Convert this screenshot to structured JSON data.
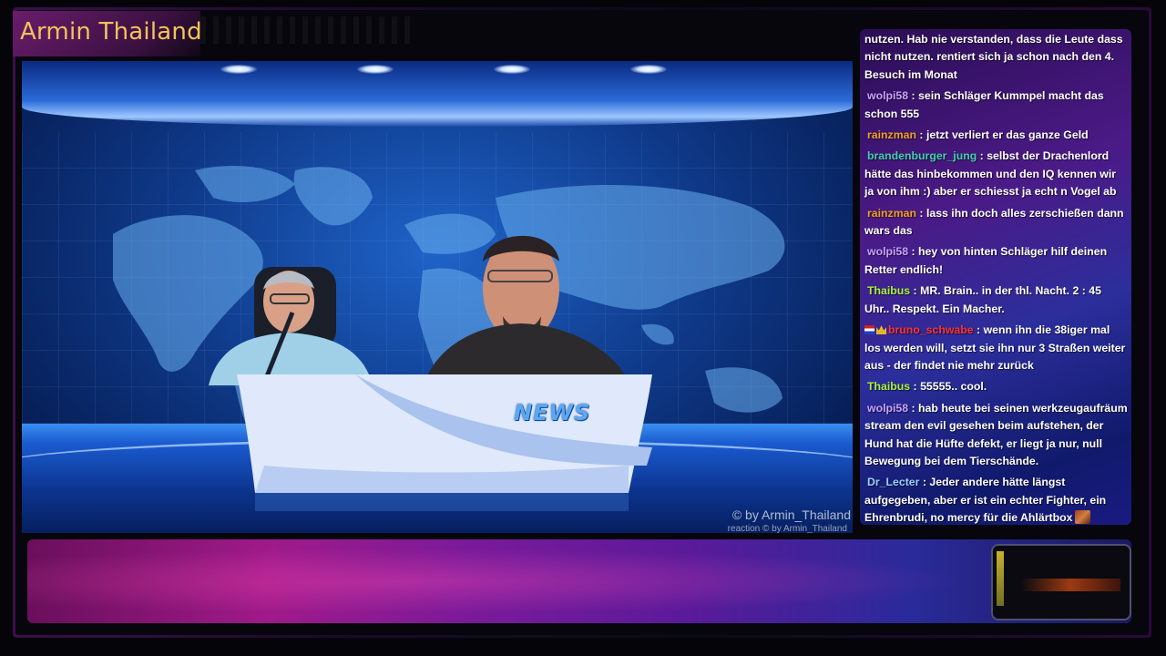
{
  "stream": {
    "title": "Armin Thailand",
    "watermark_main": "© by Armin_Thailand",
    "watermark_sub": "reaction  © by Armin_Thailand",
    "desk_label": "NEWS"
  },
  "chat": {
    "messages": [
      {
        "user": "",
        "text": "nutzen. Hab nie verstanden, dass die Leute dass nicht nutzen. rentiert sich ja schon nach den 4. Besuch im Monat",
        "color": "#ffffff"
      },
      {
        "user": "wolpi58",
        "text": "sein Schläger Kummpel macht das schon 555",
        "color": "#c9a2ff"
      },
      {
        "user": "rainzman",
        "text": "jetzt verliert er das ganze Geld",
        "color": "#f0a020"
      },
      {
        "user": "brandenburger_jung",
        "text": "selbst der Drachenlord hätte das hinbekommen und den IQ kennen wir ja von ihm :) aber er schiesst ja echt n Vogel ab",
        "color": "#40d0b0"
      },
      {
        "user": "rainzman",
        "text": "lass ihn doch alles zerschießen dann wars das",
        "color": "#f0a020"
      },
      {
        "user": "wolpi58",
        "text": "hey von hinten Schläger hilf deinen Retter endlich!",
        "color": "#c9a2ff"
      },
      {
        "user": "Thaibus",
        "text": "MR. Brain.. in der thl. Nacht. 2 : 45 Uhr.. Respekt. Ein Macher.",
        "color": "#a8f040"
      },
      {
        "user": "bruno_schwabe",
        "text": "wenn ihn die 38iger mal los werden will, setzt sie ihn nur 3 Straßen weiter aus - der findet nie mehr zurück",
        "color": "#ff3030",
        "badges": [
          "flag-de",
          "crown"
        ]
      },
      {
        "user": "Thaibus",
        "text": "55555.. cool.",
        "color": "#a8f040"
      },
      {
        "user": "wolpi58",
        "text": "hab heute bei seinen werkzeugaufräum stream den evil gesehen beim aufstehen, der Hund hat die Hüfte defekt, er liegt ja nur, null Bewegung bei dem Tierschände.",
        "color": "#c9a2ff"
      },
      {
        "user": "Dr_Lecter",
        "text": "Jeder andere hätte längst aufgegeben, aber er ist ein echter Fighter, ein Ehrenbrudi, no mercy für die Ahlärtbox",
        "color": "#9ad0ff",
        "emote": "emote-icon"
      }
    ]
  },
  "colors": {
    "title": "#f4c35a",
    "chat_bg_top": "#2b0e56",
    "banner_left": "#a01a8a"
  }
}
